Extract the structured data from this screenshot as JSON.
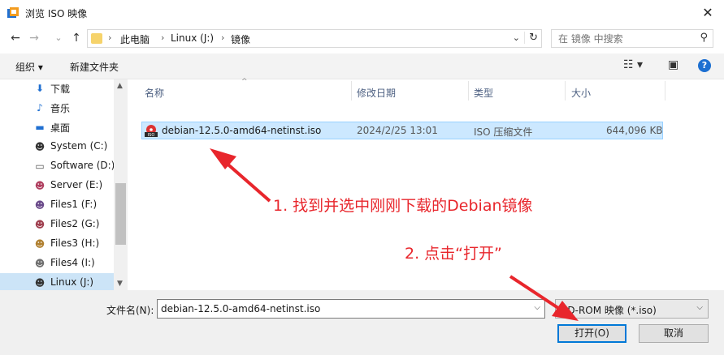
{
  "window": {
    "title": "浏览 ISO 映像",
    "close_glyph": "✕"
  },
  "nav": {
    "back": "←",
    "forward": "→",
    "recent": "⌄",
    "up": "↑"
  },
  "address": {
    "crumbs": [
      "此电脑",
      "Linux (J:)",
      "镜像"
    ],
    "separator": "›",
    "dropdown": "⌄",
    "refresh": "↻"
  },
  "search": {
    "placeholder": "在 镜像 中搜索",
    "icon": "⚲"
  },
  "toolbar": {
    "organize": "组织 ▾",
    "new_folder": "新建文件夹",
    "view_glyph": "☷ ▾",
    "preview_glyph": "▣",
    "help": "?"
  },
  "sidebar": {
    "items": [
      {
        "label": "下载",
        "icon": "download-icon",
        "glyph": "⬇",
        "color": "#1f6fd1"
      },
      {
        "label": "音乐",
        "icon": "music-icon",
        "glyph": "♪",
        "color": "#1f6fd1"
      },
      {
        "label": "桌面",
        "icon": "desktop-icon",
        "glyph": "▬",
        "color": "#1f6fd1"
      },
      {
        "label": "System (C:)",
        "icon": "drive-c-icon",
        "glyph": "☻",
        "color": "#333333"
      },
      {
        "label": "Software (D:)",
        "icon": "drive-d-icon",
        "glyph": "▭",
        "color": "#555555"
      },
      {
        "label": "Server (E:)",
        "icon": "drive-e-icon",
        "glyph": "☻",
        "color": "#b04060"
      },
      {
        "label": "Files1 (F:)",
        "icon": "drive-f-icon",
        "glyph": "☻",
        "color": "#6a4a8a"
      },
      {
        "label": "Files2 (G:)",
        "icon": "drive-g-icon",
        "glyph": "☻",
        "color": "#a04050"
      },
      {
        "label": "Files3 (H:)",
        "icon": "drive-h-icon",
        "glyph": "☻",
        "color": "#b08030"
      },
      {
        "label": "Files4 (I:)",
        "icon": "drive-i-icon",
        "glyph": "☻",
        "color": "#707070"
      },
      {
        "label": "Linux (J:)",
        "icon": "drive-j-icon",
        "glyph": "☻",
        "color": "#333333"
      }
    ],
    "selected_index": 10,
    "scroll_up": "▲",
    "scroll_down": "▼"
  },
  "filelist": {
    "columns": [
      "名称",
      "修改日期",
      "类型",
      "大小"
    ],
    "sort_caret": "^",
    "rows": [
      {
        "name": "debian-12.5.0-amd64-netinst.iso",
        "date": "2024/2/25 13:01",
        "type": "ISO 压缩文件",
        "size": "644,096 KB"
      }
    ]
  },
  "annotations": {
    "step1": "1. 找到并选中刚刚下载的Debian镜像",
    "step2": "2. 点击“打开”",
    "color": "#e8262c"
  },
  "footer": {
    "filename_label": "文件名(N):",
    "filename_value": "debian-12.5.0-amd64-netinst.iso",
    "filter_value": "CD-ROM 映像 (*.iso)",
    "dropdown": "⌵",
    "open_label": "打开(O)",
    "cancel_label": "取消"
  }
}
